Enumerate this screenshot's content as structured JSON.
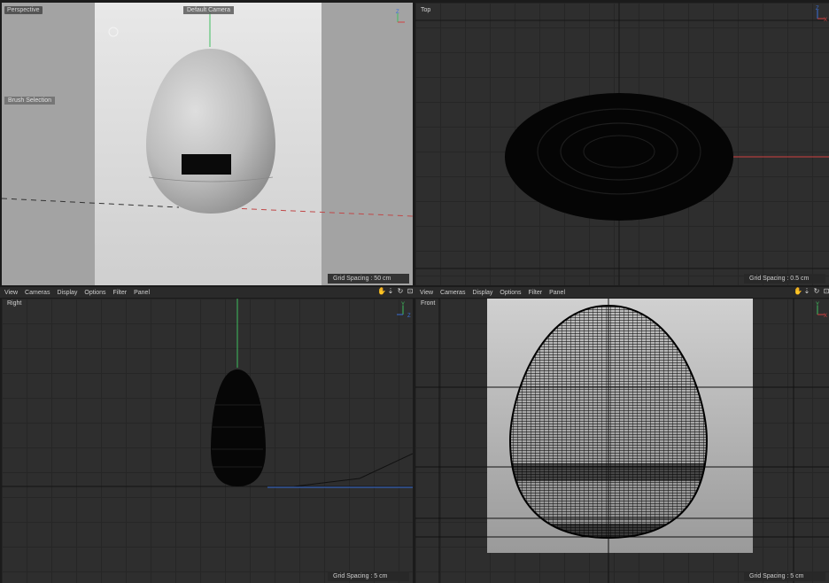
{
  "viewports": {
    "perspective": {
      "label": "Perspective",
      "camera_button": "Default Camera ",
      "brush_selection": "Brush Selection",
      "grid_spacing": "Grid Spacing : 50 cm"
    },
    "top": {
      "label": "Top",
      "grid_spacing": "Grid Spacing : 0.5 cm"
    },
    "right": {
      "label": "Right",
      "grid_spacing": "Grid Spacing : 5 cm"
    },
    "front": {
      "label": "Front",
      "grid_spacing": "Grid Spacing : 5 cm"
    }
  },
  "menu": {
    "view": "View",
    "cameras": "Cameras",
    "display": "Display",
    "options": "Options",
    "filter": "Filter",
    "panel": "Panel"
  },
  "icons": {
    "move": "hand-icon",
    "dolly": "dolly-icon",
    "rotate": "rotate-icon",
    "maximize": "maximize-icon"
  },
  "colors": {
    "axis_x": "#d04040",
    "axis_y": "#3fbf5f",
    "axis_z": "#3a6fd6",
    "viewport_bg": "#2e2e2e"
  },
  "gizmo": {
    "x": "X",
    "y": "Y",
    "z": "Z"
  }
}
